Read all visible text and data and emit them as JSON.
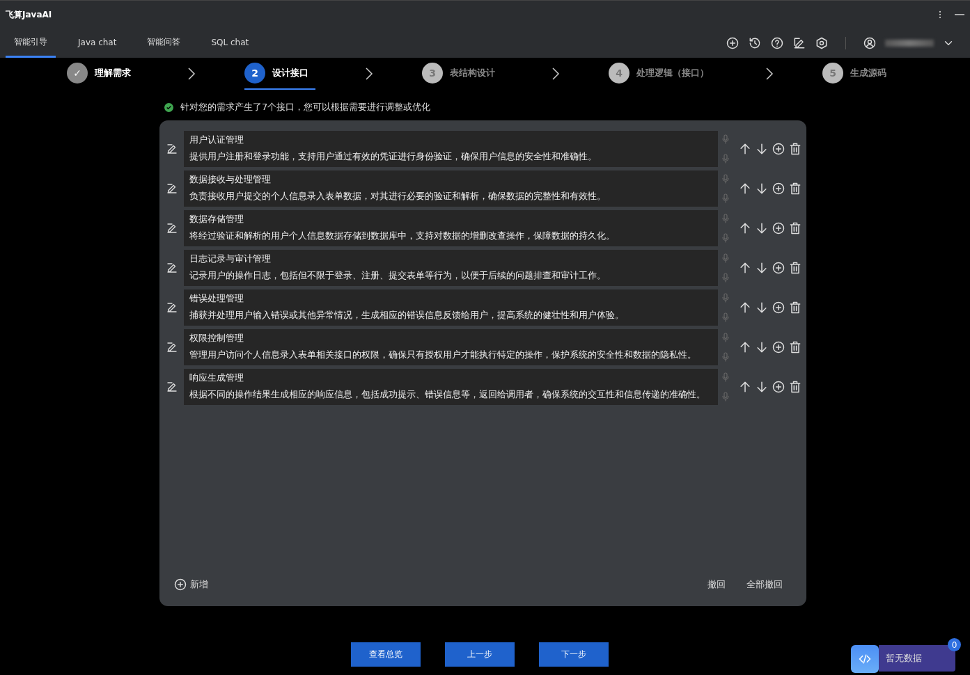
{
  "window": {
    "title": "飞算JavaAI"
  },
  "tabs": [
    {
      "label": "智能引导",
      "selected": true
    },
    {
      "label": "Java chat",
      "selected": false
    },
    {
      "label": "智能问答",
      "selected": false
    },
    {
      "label": "SQL chat",
      "selected": false
    }
  ],
  "steps": [
    {
      "marker": "✓",
      "label": "理解需求",
      "completed": true,
      "selected": false
    },
    {
      "marker": "2",
      "label": "设计接口",
      "completed": false,
      "selected": true
    },
    {
      "marker": "3",
      "label": "表结构设计",
      "completed": false,
      "selected": false
    },
    {
      "marker": "4",
      "label": "处理逻辑（接口）",
      "completed": false,
      "selected": false
    },
    {
      "marker": "5",
      "label": "生成源码",
      "completed": false,
      "selected": false
    }
  ],
  "notice": "针对您的需求产生了7个接口，您可以根据需要进行调整或优化",
  "interfaces": [
    {
      "name": "用户认证管理",
      "description": "提供用户注册和登录功能，支持用户通过有效的凭证进行身份验证，确保用户信息的安全性和准确性。"
    },
    {
      "name": "数据接收与处理管理",
      "description": "负责接收用户提交的个人信息录入表单数据，对其进行必要的验证和解析，确保数据的完整性和有效性。"
    },
    {
      "name": "数据存储管理",
      "description": "将经过验证和解析的用户个人信息数据存储到数据库中，支持对数据的增删改查操作，保障数据的持久化。"
    },
    {
      "name": "日志记录与审计管理",
      "description": "记录用户的操作日志，包括但不限于登录、注册、提交表单等行为，以便于后续的问题排查和审计工作。"
    },
    {
      "name": "错误处理管理",
      "description": "捕获并处理用户输入错误或其他异常情况，生成相应的错误信息反馈给用户，提高系统的健壮性和用户体验。"
    },
    {
      "name": "权限控制管理",
      "description": "管理用户访问个人信息录入表单相关接口的权限，确保只有授权用户才能执行特定的操作，保护系统的安全性和数据的隐私性。"
    },
    {
      "name": "响应生成管理",
      "description": "根据不同的操作结果生成相应的响应信息，包括成功提示、错误信息等，返回给调用者，确保系统的交互性和信息传递的准确性。"
    }
  ],
  "panel_actions": {
    "add": "新增",
    "undo": "撤回",
    "undo_all": "全部撤回"
  },
  "buttons": [
    "查看总览",
    "上一步",
    "下一步"
  ],
  "widget": {
    "label": "暂无数据",
    "count": "0"
  }
}
